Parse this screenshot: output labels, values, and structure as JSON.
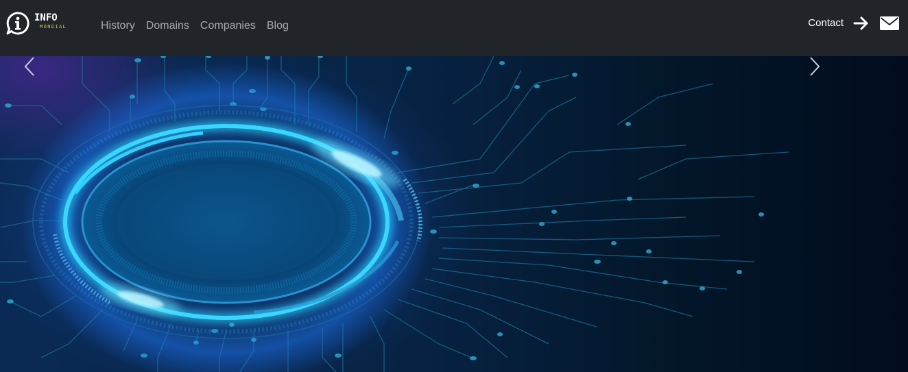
{
  "brand": {
    "title": "INFO",
    "subtitle": "MONDIAL",
    "icon": "info-chat-bubble-icon"
  },
  "nav": {
    "links": [
      "History",
      "Domains",
      "Companies",
      "Blog"
    ]
  },
  "header_right": {
    "contact_label": "Contact",
    "arrow_icon": "arrow-right-icon",
    "mail_icon": "envelope-icon"
  },
  "carousel": {
    "prev_icon": "chevron-left-icon",
    "next_icon": "chevron-right-icon",
    "slide_image": "circuit-ring-illustration"
  },
  "colors": {
    "navbar_bg": "#212529",
    "brand_accent": "#d9c14a",
    "ring_glow": "#27c9f5",
    "circuit_lines": "#1f6f8f"
  }
}
